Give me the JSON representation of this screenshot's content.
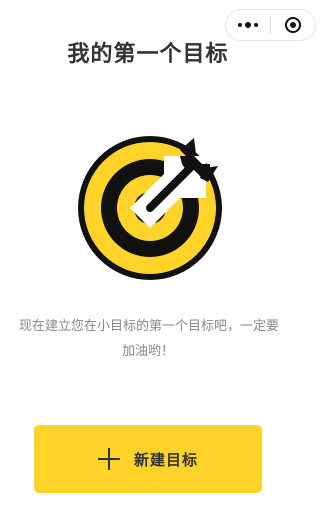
{
  "capsule": {
    "more_icon": "more-dots-icon",
    "close_icon": "close-target-icon"
  },
  "header": {
    "title": "我的第一个目标"
  },
  "illustration": {
    "icon": "target-dart-icon",
    "colors": {
      "ring_dark": "#111111",
      "ring_yellow": "#ffd329"
    }
  },
  "message": {
    "line1": "现在建立您在小目标的第一个目标吧，一定要",
    "line2": "加油哟！"
  },
  "actions": {
    "new_goal_label": "新建目标",
    "new_goal_icon": "plus-icon",
    "button_color": "#ffd329"
  }
}
